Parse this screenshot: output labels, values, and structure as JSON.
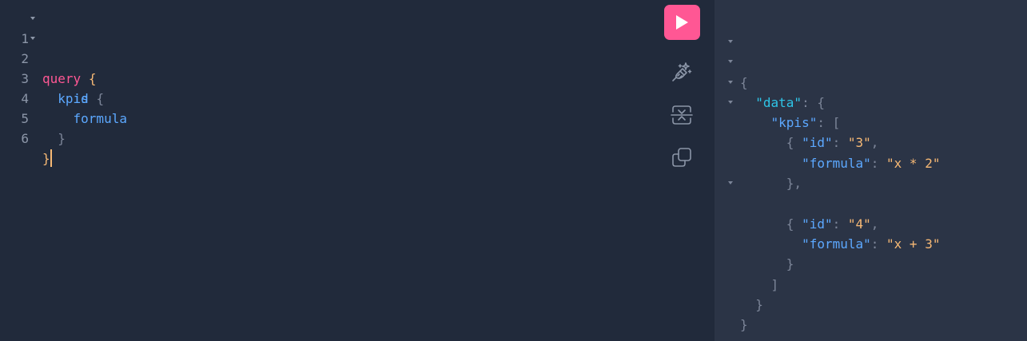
{
  "editor": {
    "lines": [
      {
        "num": "1",
        "kw": "query",
        "brace": "{"
      },
      {
        "num": "2",
        "field": "kpis",
        "brace": "{"
      },
      {
        "num": "3",
        "field": "id"
      },
      {
        "num": "4",
        "field": "formula"
      },
      {
        "num": "5",
        "brace": "}"
      },
      {
        "num": "6",
        "brace": "}"
      }
    ]
  },
  "toolbar": {
    "run_icon": "play-icon",
    "prettify_icon": "magic-wand-icon",
    "merge_icon": "merge-fragments-icon",
    "copy_icon": "copy-icon",
    "run_color": "#ff5794"
  },
  "result": {
    "open_root": "{",
    "data_key": "\"data\"",
    "colon": ": ",
    "open_obj": "{",
    "kpis_key": "\"kpis\"",
    "open_arr": "[",
    "items": [
      {
        "id_key": "\"id\"",
        "id_val": "\"3\"",
        "formula_key": "\"formula\"",
        "formula_val": "\"x * 2\"",
        "close": "},"
      },
      {
        "id_key": "\"id\"",
        "id_val": "\"4\"",
        "formula_key": "\"formula\"",
        "formula_val": "\"x + 3\"",
        "close": "}"
      }
    ],
    "close_arr": "]",
    "close_data": "}",
    "close_root": "}",
    "item_open": "{",
    "comma": ","
  }
}
